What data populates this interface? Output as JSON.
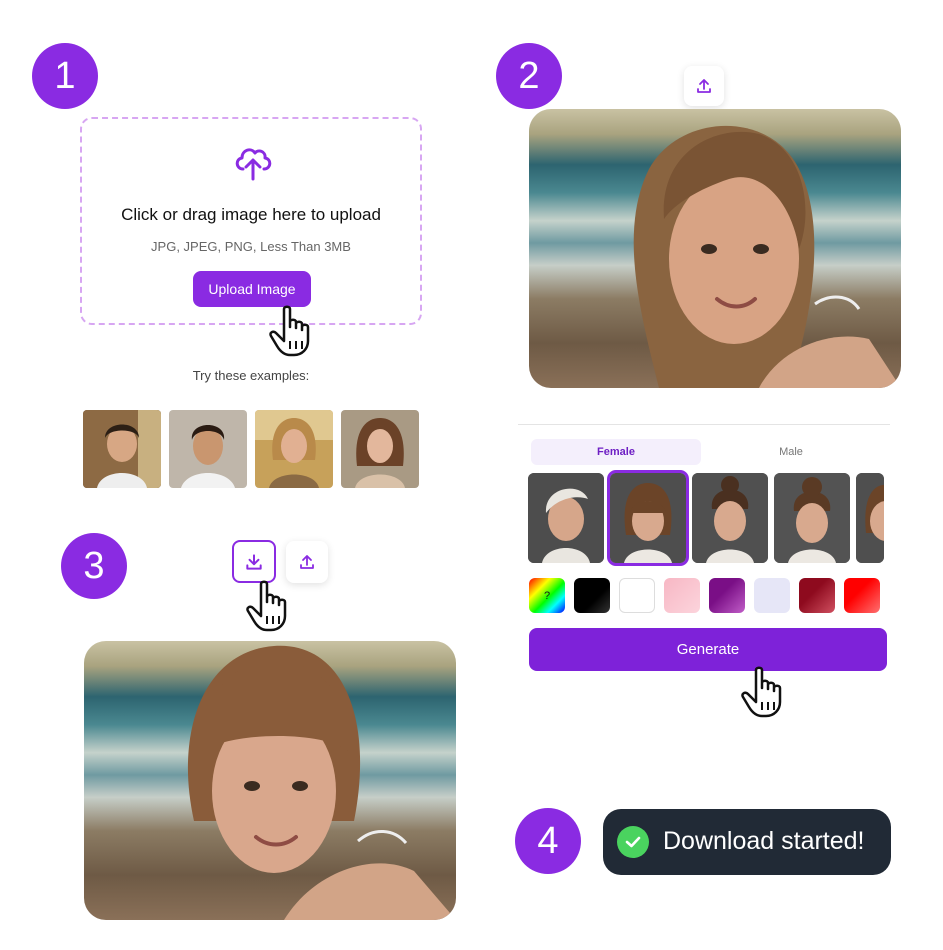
{
  "steps": [
    "1",
    "2",
    "3",
    "4"
  ],
  "upload": {
    "icon": "cloud-upload-icon",
    "title": "Click or drag image here to upload",
    "subtitle": "JPG, JPEG, PNG, Less Than 3MB",
    "button_label": "Upload Image",
    "examples_label": "Try these examples:",
    "examples": [
      "example-man-curly",
      "example-man-dark",
      "example-woman-blonde",
      "example-woman-brunette"
    ]
  },
  "preview": {
    "upload_icon": "upload-icon"
  },
  "tabs": {
    "female": "Female",
    "male": "Male"
  },
  "styles": [
    "undercut-pixie",
    "bob-with-bangs",
    "updo-braid",
    "updo-top-bun",
    "partial-style"
  ],
  "colors": [
    "#rainbow-random",
    "#000000",
    "#ffffff",
    "#f7b7c4",
    "#7a0f86",
    "#e6e6f7",
    "#8e0a1e",
    "#ff0000"
  ],
  "random_color_mark": "?",
  "generate_label": "Generate",
  "result": {
    "download_icon": "download-icon",
    "upload_icon": "upload-icon"
  },
  "toast": {
    "message": "Download started!"
  },
  "accent_color": "#8a2be2"
}
